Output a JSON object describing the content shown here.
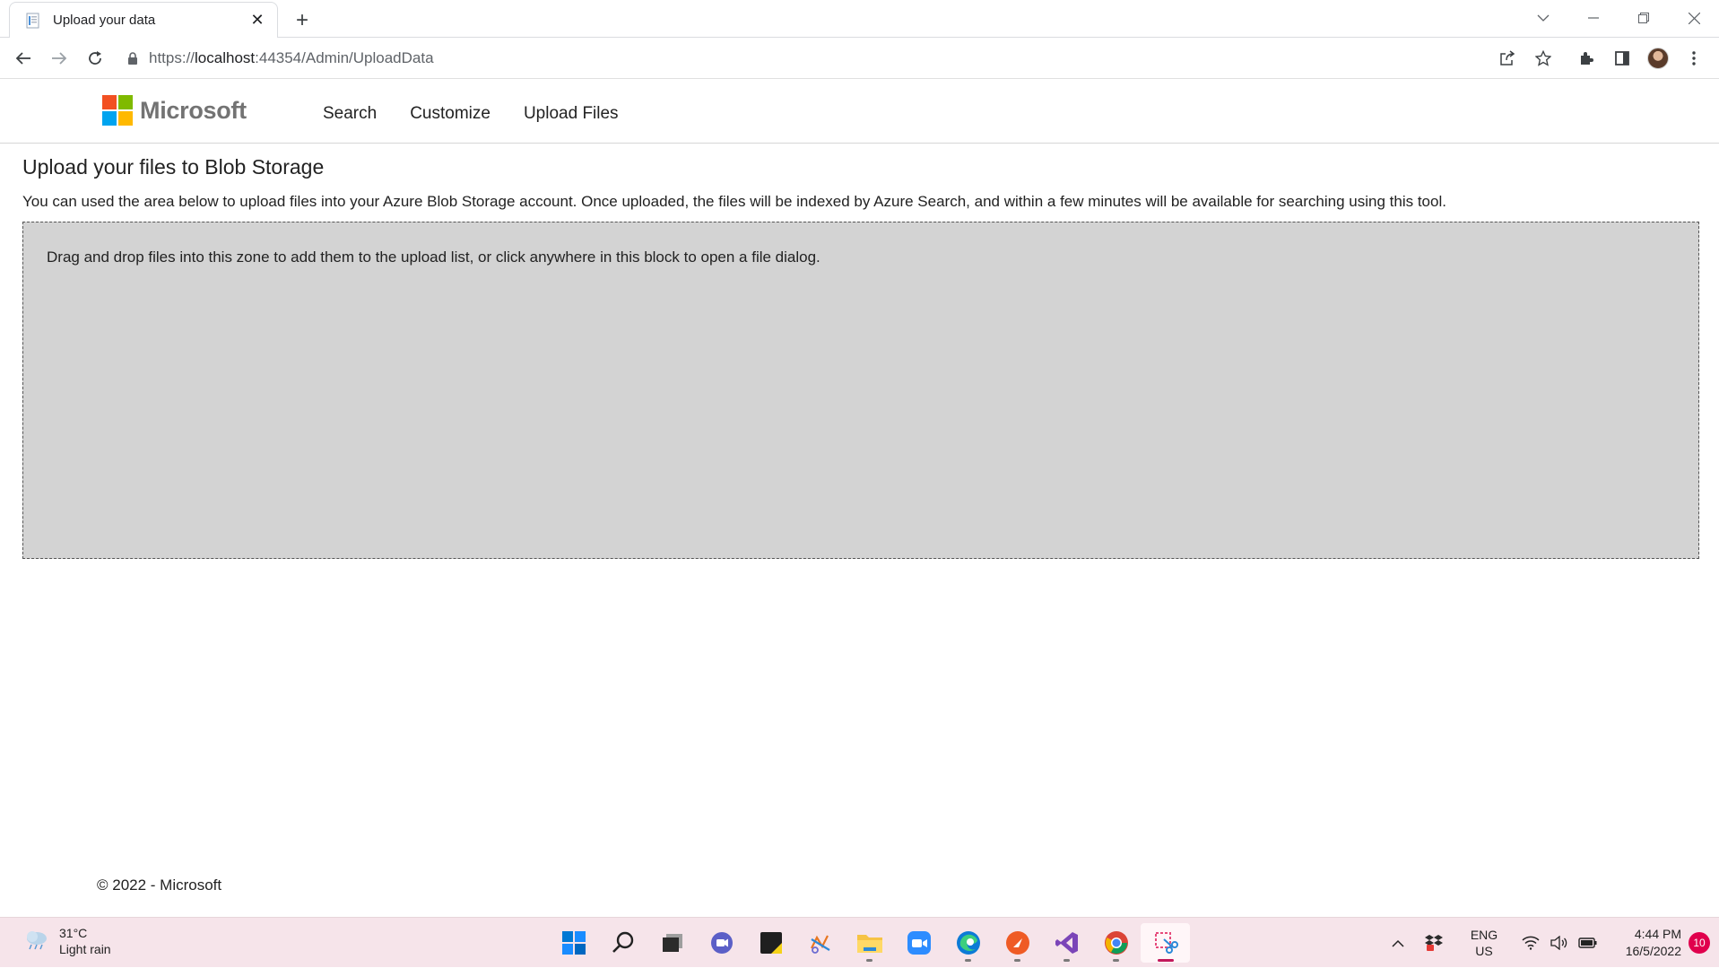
{
  "browser": {
    "tab_title": "Upload your data",
    "url_prefix": "https://",
    "url_host": "localhost",
    "url_path": ":44354/Admin/UploadData"
  },
  "site": {
    "brand": "Microsoft",
    "nav": [
      "Search",
      "Customize",
      "Upload Files"
    ]
  },
  "main": {
    "title": "Upload your files to Blob Storage",
    "description": "You can used the area below to upload files into your Azure Blob Storage account. Once uploaded, the files will be indexed by Azure Search, and within a few minutes will be available for searching using this tool.",
    "dropzone_message": "Drag and drop files into this zone to add them to the upload list, or click anywhere in this block to open a file dialog."
  },
  "footer": {
    "text": "© 2022 - Microsoft"
  },
  "taskbar": {
    "weather_temp": "31°C",
    "weather_desc": "Light rain",
    "lang_line1": "ENG",
    "lang_line2": "US",
    "time": "4:44 PM",
    "date": "16/5/2022",
    "notifications": "10"
  },
  "colors": {
    "ms_red": "#f25022",
    "ms_green": "#7fba00",
    "ms_blue": "#00a4ef",
    "ms_yellow": "#ffb900",
    "dropzone_bg": "#d3d3d3",
    "taskbar_bg": "#f6e4ea"
  }
}
